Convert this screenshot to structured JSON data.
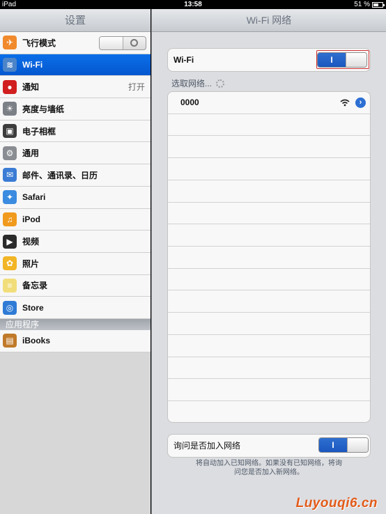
{
  "status_bar": {
    "carrier": "iPad",
    "time": "13:58",
    "battery": "51 %",
    "battery_level": 0.51
  },
  "master": {
    "title": "设置",
    "rows": [
      {
        "label": "飞行模式",
        "icon": "airplane-icon",
        "color": "#f08a2c",
        "glyph": "✈",
        "switch": "off"
      },
      {
        "label": "Wi-Fi",
        "icon": "wifi-icon",
        "color": "#4b84c9",
        "glyph": "≋",
        "selected": true
      },
      {
        "label": "通知",
        "icon": "notifications-icon",
        "color": "#d11f1f",
        "glyph": "●",
        "value": "打开"
      },
      {
        "label": "亮度与墙纸",
        "icon": "brightness-icon",
        "color": "#7b7f86",
        "glyph": "☀"
      },
      {
        "label": "电子相框",
        "icon": "picture-frame-icon",
        "color": "#3c3c3c",
        "glyph": "▣"
      },
      {
        "label": "通用",
        "icon": "general-gear-icon",
        "color": "#8a8d92",
        "glyph": "⚙"
      },
      {
        "label": "邮件、通讯录、日历",
        "icon": "mail-icon",
        "color": "#3b7cd4",
        "glyph": "✉"
      },
      {
        "label": "Safari",
        "icon": "safari-compass-icon",
        "color": "#3b8be0",
        "glyph": "✦"
      },
      {
        "label": "iPod",
        "icon": "ipod-icon",
        "color": "#f09a1e",
        "glyph": "♫"
      },
      {
        "label": "视频",
        "icon": "video-icon",
        "color": "#2b2b2b",
        "glyph": "▶"
      },
      {
        "label": "照片",
        "icon": "photos-sunflower-icon",
        "color": "#f2b526",
        "glyph": "✿"
      },
      {
        "label": "备忘录",
        "icon": "notes-icon",
        "color": "#f1de7a",
        "glyph": "≡"
      },
      {
        "label": "Store",
        "icon": "store-icon",
        "color": "#2f7bd6",
        "glyph": "◎"
      }
    ],
    "apps_section_header": "应用程序",
    "apps": [
      {
        "label": "iBooks",
        "icon": "ibooks-icon",
        "color": "#c07a2a",
        "glyph": "▤"
      }
    ]
  },
  "detail": {
    "title": "Wi-Fi 网络",
    "wifi_label": "Wi-Fi",
    "wifi_switch_on_label": "I",
    "choose_network_label": "选取网络...",
    "networks": [
      {
        "name": "0000"
      }
    ],
    "ask_join_label": "询问是否加入网络",
    "ask_join_switch_on_label": "I",
    "footnote_line1": "将自动加入已知网络。如果没有已知网络，将询",
    "footnote_line2": "问您是否加入新网络。"
  },
  "watermark": "Luyouqi6.cn",
  "colors": {
    "selected_row": "#0558cf",
    "switch_on": "#1a57bf",
    "watermark": "#e25b1a"
  }
}
